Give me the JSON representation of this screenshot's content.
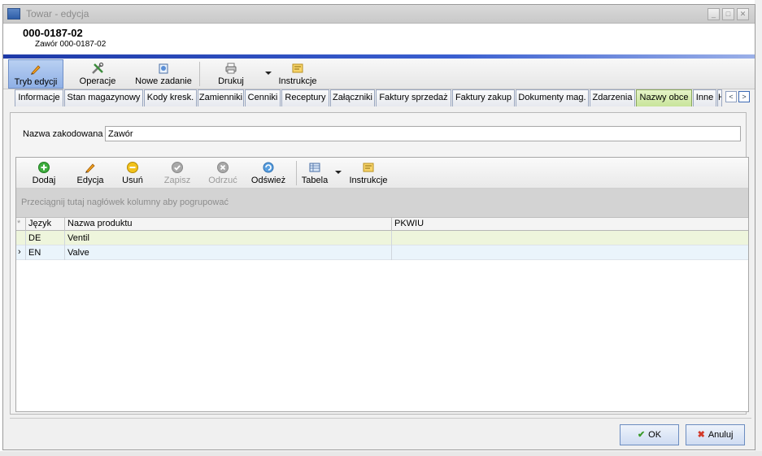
{
  "window": {
    "title": "Towar - edycja"
  },
  "header": {
    "code": "000-0187-02",
    "subtitle": "Zawór 000-0187-02"
  },
  "toolbar": {
    "edit_mode": "Tryb edycji",
    "operations": "Operacje",
    "new_task": "Nowe zadanie",
    "print": "Drukuj",
    "instructions": "Instrukcje"
  },
  "tabs": [
    "Informacje",
    "Stan magazynowy",
    "Kody kresk.",
    "Zamienniki",
    "Cenniki",
    "Receptury",
    "Załączniki",
    "Faktury sprzedaż",
    "Faktury zakup",
    "Dokumenty mag.",
    "Zdarzenia",
    "Nazwy obce",
    "Inne",
    "H"
  ],
  "active_tab": "Nazwy obce",
  "form": {
    "coded_name_label": "Nazwa zakodowana",
    "coded_name_value": "Zawór"
  },
  "grid_toolbar": {
    "add": "Dodaj",
    "edit": "Edycja",
    "delete": "Usuń",
    "save": "Zapisz",
    "discard": "Odrzuć",
    "refresh": "Odśwież",
    "table": "Tabela",
    "instructions": "Instrukcje"
  },
  "grid": {
    "group_hint": "Przeciągnij tutaj nagłówek kolumny aby pogrupować",
    "columns": [
      "Język",
      "Nazwa produktu",
      "PKWIU"
    ],
    "rows": [
      {
        "lang": "DE",
        "name": "Ventil",
        "pkwiu": ""
      },
      {
        "lang": "EN",
        "name": "Valve",
        "pkwiu": ""
      }
    ]
  },
  "buttons": {
    "ok": "OK",
    "cancel": "Anuluj"
  },
  "colors": {
    "active_tab": "#c8e49a",
    "accent_bar": "#1e3aa8",
    "active_toolbar": "#8fb0e6"
  }
}
